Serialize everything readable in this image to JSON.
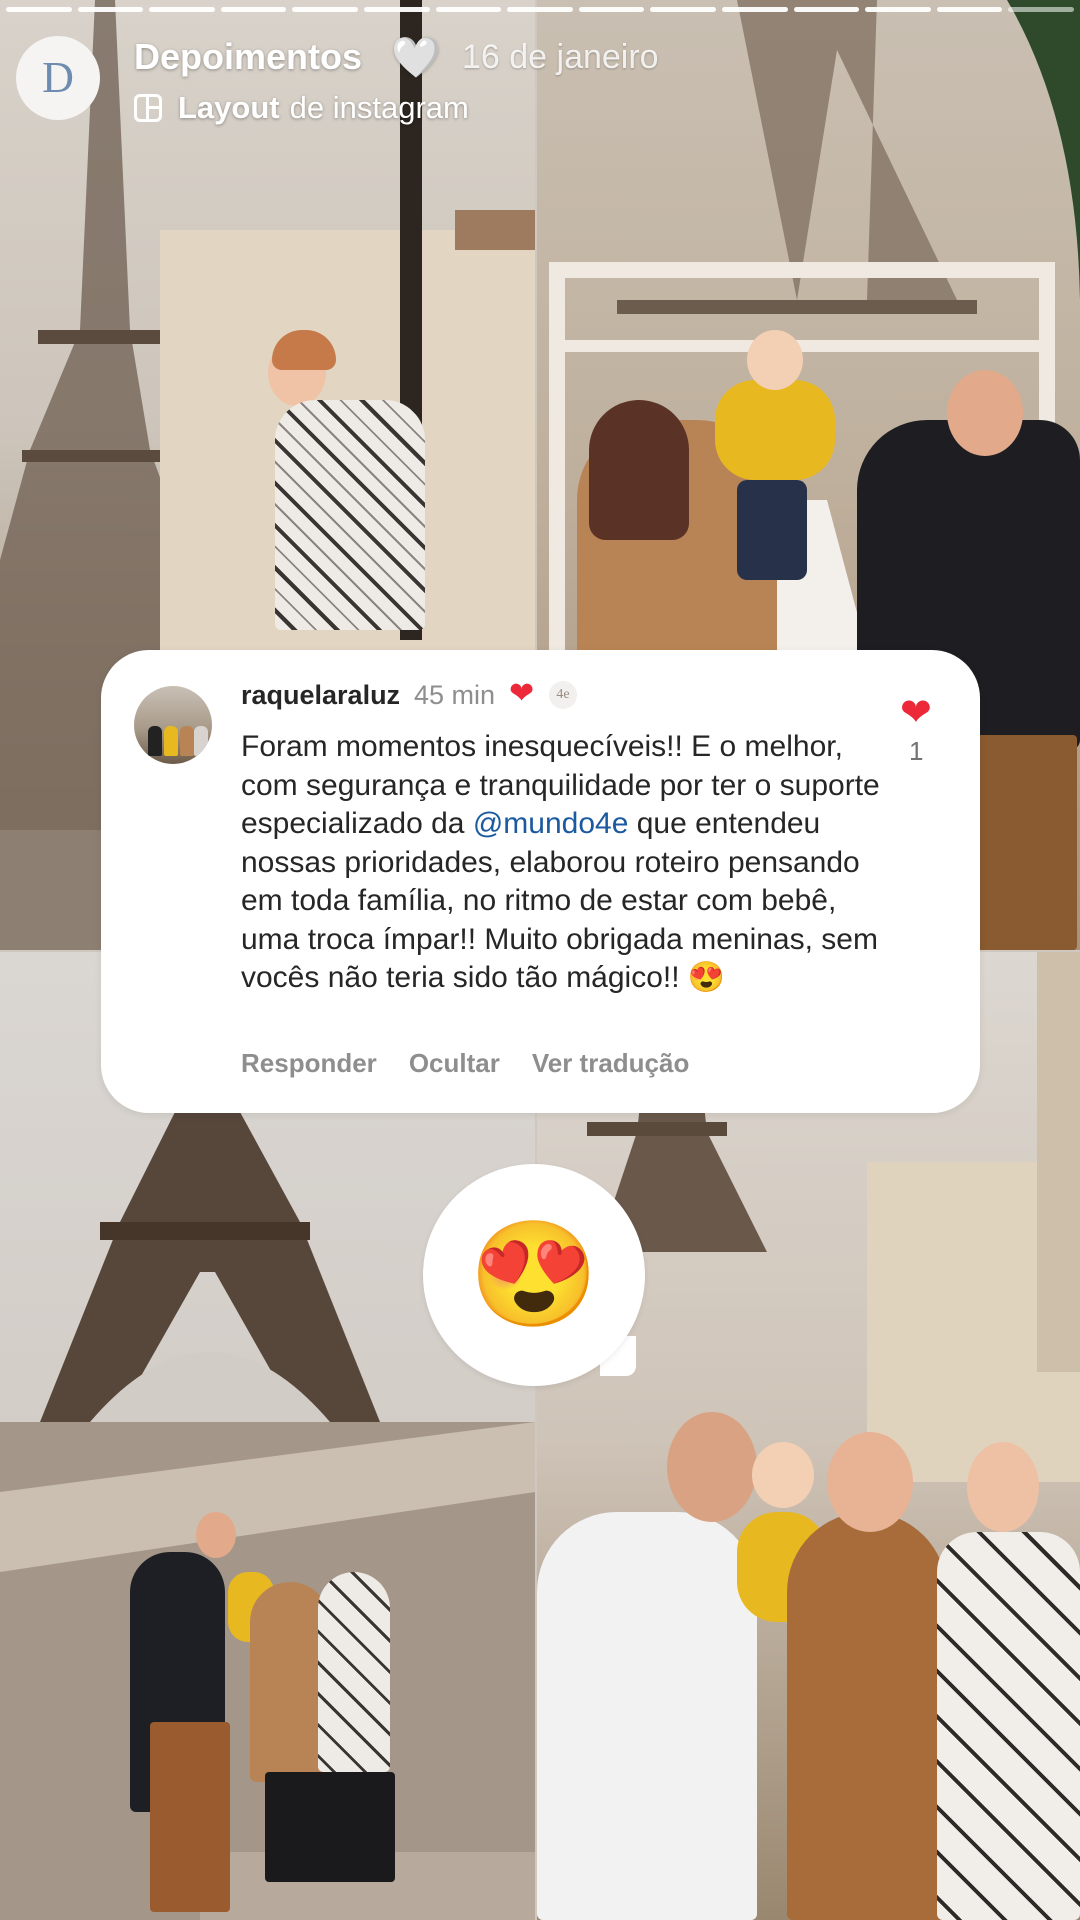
{
  "story": {
    "progress_segments": 15,
    "progress_done": 14
  },
  "header": {
    "avatar_letter": "D",
    "title": "Depoimentos",
    "title_heart": "🤍",
    "time": "16 de janeiro",
    "layout_bold": "Layout",
    "layout_rest": "de instagram",
    "layout_icon": "layout-grid-icon"
  },
  "comment": {
    "username": "raquelaraluz",
    "time": "45 min",
    "author_liked_icon": "heart-icon",
    "author_badge": "4e",
    "text_part1": "Foram momentos inesquecíveis!! E o melhor, com segurança e tranquilidade por ter o suporte especializado da ",
    "mention": "@mundo4e",
    "text_part2": " que entendeu nossas prioridades, elaborou roteiro pensando em toda família, no ritmo de estar com bebê, uma troca ímpar!! Muito obrigada meninas, sem vocês não teria sido tão mágico!! 😍",
    "actions": [
      "Responder",
      "Ocultar",
      "Ver tradução"
    ],
    "like_count": "1",
    "colors": {
      "like": "#ed2939",
      "mention": "#1c5aa0",
      "secondary": "#8e8e8e"
    }
  },
  "sticker": {
    "emoji": "😍"
  }
}
